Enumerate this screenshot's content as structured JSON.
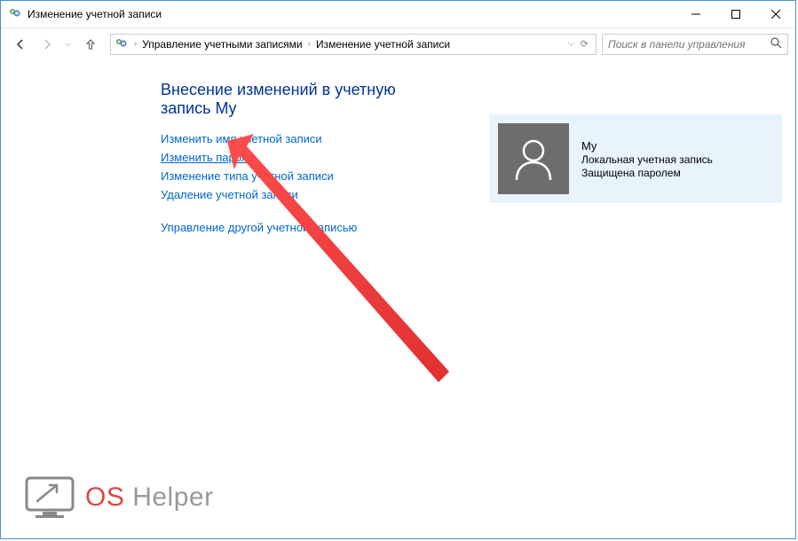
{
  "window": {
    "title": "Изменение учетной записи"
  },
  "breadcrumb": {
    "items": [
      "Управление учетными записями",
      "Изменение учетной записи"
    ]
  },
  "search": {
    "placeholder": "Поиск в панели управления"
  },
  "page": {
    "heading": "Внесение изменений в учетную запись My"
  },
  "links": {
    "change_name": "Изменить имя учетной записи",
    "change_password": "Изменить пароль",
    "change_type": "Изменение типа учетной записи",
    "delete": "Удаление учетной записи",
    "manage_other": "Управление другой учетной записью"
  },
  "account": {
    "name": "My",
    "type": "Локальная учетная запись",
    "protected": "Защищена паролем"
  },
  "watermark": {
    "os": "OS",
    "helper": "Helper"
  }
}
